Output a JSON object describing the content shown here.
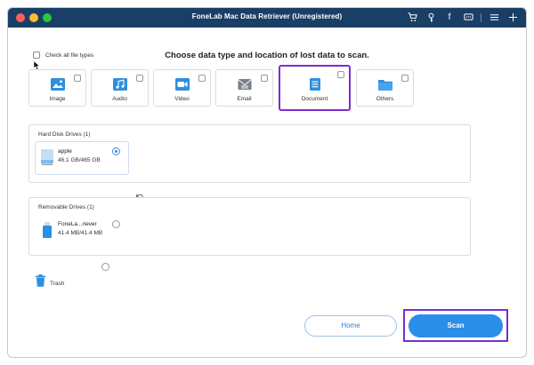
{
  "window": {
    "title": "FoneLab Mac Data Retriever (Unregistered)"
  },
  "titlebar_icons": [
    "cart-icon",
    "key-icon",
    "facebook-icon",
    "chat-icon",
    "menu-icon",
    "pin-icon"
  ],
  "titlebar_glyphs": {
    "facebook": "f"
  },
  "heading": "Choose data type and location of lost data to scan.",
  "check_all": {
    "label": "Check all file types",
    "checked": false
  },
  "file_types": [
    {
      "label": "Image",
      "icon": "image-icon",
      "checked": false
    },
    {
      "label": "Audio",
      "icon": "music-icon",
      "checked": false
    },
    {
      "label": "Video",
      "icon": "video-icon",
      "checked": false
    },
    {
      "label": "Email",
      "icon": "email-icon",
      "checked": false
    },
    {
      "label": "Document",
      "icon": "document-icon",
      "checked": false,
      "highlighted": true
    },
    {
      "label": "Others",
      "icon": "folder-icon",
      "checked": false
    }
  ],
  "hard_disk": {
    "title": "Hard Disk Drives (1)",
    "drives": [
      {
        "name": "apple",
        "size": "46.1 GB/465 GB",
        "selected": true
      }
    ]
  },
  "removable": {
    "title": "Removable Drives (1)",
    "drives": [
      {
        "name": "FoneLa...riever",
        "size": "41.4 MB/41.4 MB",
        "selected": false
      }
    ]
  },
  "trash": {
    "label": "Trash",
    "selected": false
  },
  "buttons": {
    "home": "Home",
    "scan": "Scan"
  },
  "colors": {
    "titlebar": "#1a3f66",
    "accent": "#2b8ee8",
    "highlight": "#7b2dd1"
  }
}
